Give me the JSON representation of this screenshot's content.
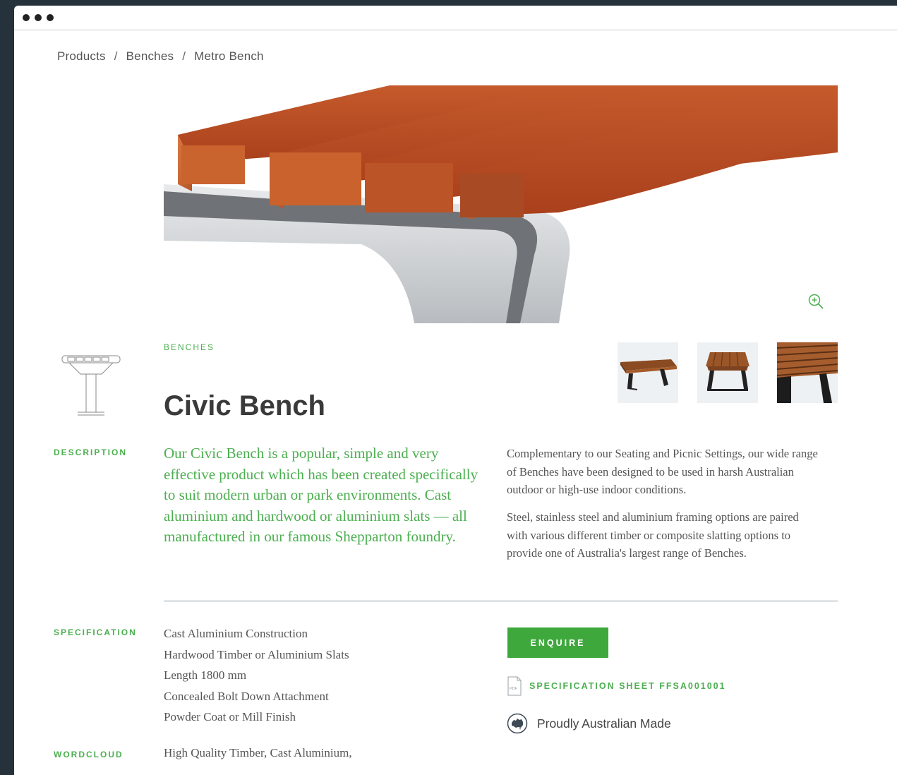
{
  "breadcrumb": {
    "items": [
      "Products",
      "Benches",
      "Metro Bench"
    ],
    "separator": "/"
  },
  "product": {
    "category": "BENCHES",
    "title": "Civic Bench"
  },
  "description": {
    "label": "DESCRIPTION",
    "lead": "Our Civic Bench is a popular, simple and very effective product which has been created specifically to suit modern urban or park environments. Cast aluminium and hardwood or aluminium slats — all manufactured in our famous Shepparton foundry.",
    "paragraph_1": "Complementary to our Seating and Picnic Settings, our wide range of Benches have been designed to be used in harsh Australian outdoor or high-use indoor conditions.",
    "paragraph_2": "Steel, stainless steel and aluminium framing options are paired with various different timber or composite slatting options to provide one of Australia's largest range of Benches."
  },
  "specification": {
    "label": "SPECIFICATION",
    "items": [
      "Cast Aluminium Construction",
      "Hardwood Timber or Aluminium Slats",
      "Length 1800 mm",
      "Concealed Bolt Down Attachment",
      "Powder Coat or Mill Finish"
    ]
  },
  "actions": {
    "enquire_label": "ENQUIRE",
    "pdf_icon_label": "PDF",
    "spec_sheet_label": "SPECIFICATION SHEET FFSA001001",
    "made_in": "Proudly Australian Made"
  },
  "wordcloud": {
    "label": "WORDCLOUD",
    "text": "High Quality Timber, Cast Aluminium,"
  },
  "icons": {
    "zoom": "zoom-in-icon",
    "pdf": "pdf-icon",
    "australia": "australia-icon",
    "menu": "menu-icon"
  },
  "colors": {
    "accent_green": "#4caf50",
    "button_green": "#3fa83d",
    "text_dark": "#3a3a3a",
    "text_body": "#555555",
    "frame": "#26323b"
  }
}
